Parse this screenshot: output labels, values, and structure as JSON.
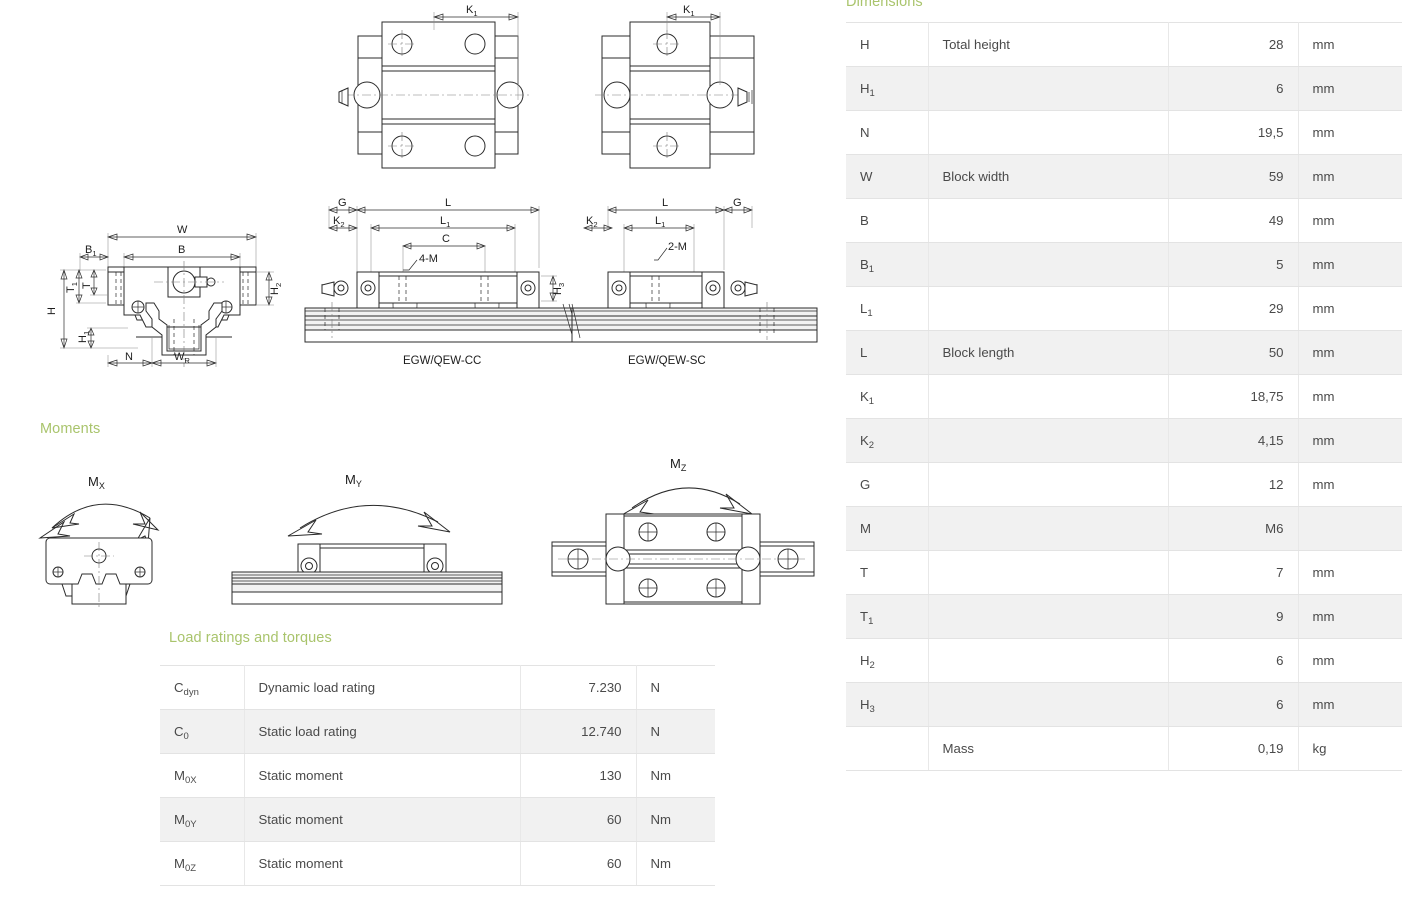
{
  "sections": {
    "dimensions_title": "Dimensions",
    "moments_title": "Moments",
    "load_title": "Load ratings and torques"
  },
  "colors": {
    "heading_green": "#a9c46c",
    "text": "#4a4a4a",
    "row_alt": "#f1f1f1",
    "border": "#e3e3e3",
    "drawing_line": "#2b2b2b"
  },
  "dimensions_table": {
    "rows": [
      {
        "symbol": "H",
        "sub": "",
        "desc": "Total height",
        "value": "28",
        "unit": "mm"
      },
      {
        "symbol": "H",
        "sub": "1",
        "desc": "",
        "value": "6",
        "unit": "mm"
      },
      {
        "symbol": "N",
        "sub": "",
        "desc": "",
        "value": "19,5",
        "unit": "mm"
      },
      {
        "symbol": "W",
        "sub": "",
        "desc": "Block width",
        "value": "59",
        "unit": "mm"
      },
      {
        "symbol": "B",
        "sub": "",
        "desc": "",
        "value": "49",
        "unit": "mm"
      },
      {
        "symbol": "B",
        "sub": "1",
        "desc": "",
        "value": "5",
        "unit": "mm"
      },
      {
        "symbol": "L",
        "sub": "1",
        "desc": "",
        "value": "29",
        "unit": "mm"
      },
      {
        "symbol": "L",
        "sub": "",
        "desc": "Block length",
        "value": "50",
        "unit": "mm"
      },
      {
        "symbol": "K",
        "sub": "1",
        "desc": "",
        "value": "18,75",
        "unit": "mm"
      },
      {
        "symbol": "K",
        "sub": "2",
        "desc": "",
        "value": "4,15",
        "unit": "mm"
      },
      {
        "symbol": "G",
        "sub": "",
        "desc": "",
        "value": "12",
        "unit": "mm"
      },
      {
        "symbol": "M",
        "sub": "",
        "desc": "",
        "value": "M6",
        "unit": ""
      },
      {
        "symbol": "T",
        "sub": "",
        "desc": "",
        "value": "7",
        "unit": "mm"
      },
      {
        "symbol": "T",
        "sub": "1",
        "desc": "",
        "value": "9",
        "unit": "mm"
      },
      {
        "symbol": "H",
        "sub": "2",
        "desc": "",
        "value": "6",
        "unit": "mm"
      },
      {
        "symbol": "H",
        "sub": "3",
        "desc": "",
        "value": "6",
        "unit": "mm"
      },
      {
        "symbol": "",
        "sub": "",
        "desc": "Mass",
        "value": "0,19",
        "unit": "kg"
      }
    ]
  },
  "load_table": {
    "rows": [
      {
        "symbol": "C",
        "sub": "dyn",
        "desc": "Dynamic load rating",
        "value": "7.230",
        "unit": "N"
      },
      {
        "symbol": "C",
        "sub": "0",
        "desc": "Static load rating",
        "value": "12.740",
        "unit": "N"
      },
      {
        "symbol": "M",
        "sub": "0X",
        "desc": "Static moment",
        "value": "130",
        "unit": "Nm"
      },
      {
        "symbol": "M",
        "sub": "0Y",
        "desc": "Static moment",
        "value": "60",
        "unit": "Nm"
      },
      {
        "symbol": "M",
        "sub": "0Z",
        "desc": "Static moment",
        "value": "60",
        "unit": "Nm"
      }
    ]
  },
  "drawings": {
    "top_view_left": {
      "label": "K",
      "label_sub": "1"
    },
    "top_view_right": {
      "label": "K",
      "label_sub": "1"
    },
    "front_view": {
      "labels": [
        "W",
        "B",
        "B1",
        "T1",
        "T",
        "H",
        "H1",
        "H2",
        "N",
        "WR"
      ]
    },
    "side_view_cc": {
      "caption": "EGW/QEW-CC",
      "labels": [
        "G",
        "K2",
        "L",
        "L1",
        "C",
        "4-M",
        "H3"
      ]
    },
    "side_view_sc": {
      "caption": "EGW/QEW-SC",
      "labels": [
        "K2",
        "L",
        "L1",
        "G",
        "2-M"
      ]
    },
    "moment_mx": {
      "label": "M",
      "label_sub": "X"
    },
    "moment_my": {
      "label": "M",
      "label_sub": "Y"
    },
    "moment_mz": {
      "label": "M",
      "label_sub": "Z"
    }
  }
}
